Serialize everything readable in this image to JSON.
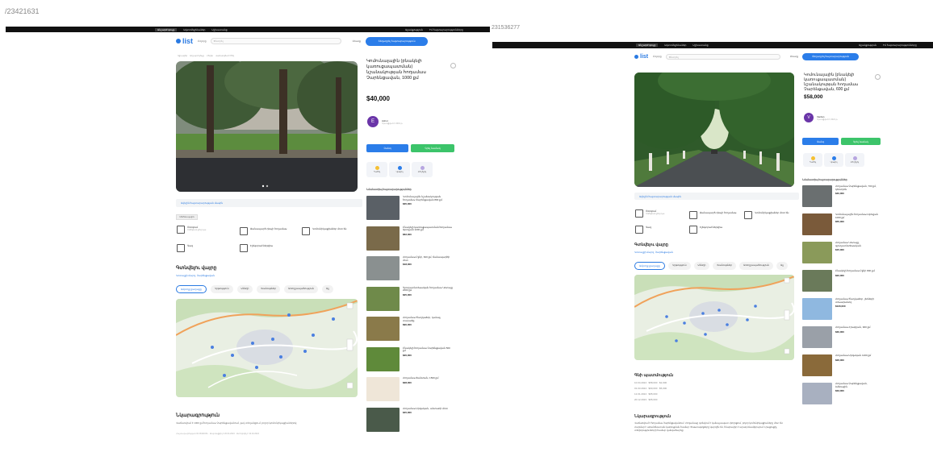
{
  "page_ids": {
    "left": "/23421631",
    "right": "231536277"
  },
  "topbar": {
    "items": [
      "Անշարժ գույք",
      "Ավտոմեքենաներ",
      "Աշխատանք"
    ],
    "right_items": [
      "Աջակցություն",
      "Իմ հայտարարությունները"
    ]
  },
  "header": {
    "logo": "list",
    "category": "Բոլորը",
    "search_placeholder": "Փնտրել",
    "login": "Մուտք",
    "post_button": "Տեղադրել հայտարարություն"
  },
  "left_listing": {
    "breadcrumbs": [
      "Գլխավոր",
      "Անշարժ գույք",
      "Հողեր",
      "Վաճառվում է հող"
    ],
    "title": "Կոմունալային (բնակելի կառուցապատման) նշանակության հողամաս Չարենցավան, 1000 քմ",
    "price": "$40,000",
    "seller": {
      "initial": "E",
      "name": "Ashot",
      "sub": "Գրանցված է 2019 թ."
    },
    "call_button": "Զանգ",
    "message_button": "Գրել նամակ",
    "actions": [
      "Պահել",
      "Կիսվել",
      "Բողոքել"
    ],
    "info_bar": "Ավելին հայտարարության մասին",
    "chip": "Կոմունալային",
    "features": [
      {
        "label": "Ոռոգում",
        "sub": "Ոռոգման ջուր կա"
      },
      {
        "label": "Ճանապարհ դեպի հողամաս",
        "sub": ""
      },
      {
        "label": "Կոմունիկացիաներ մոտ են",
        "sub": ""
      },
      {
        "label": "Գազ",
        "sub": ""
      },
      {
        "label": "Էլեկտրաէներգիա",
        "sub": ""
      }
    ],
    "location_title": "Գտնվելու վայրը",
    "address": "Կոտայքի մարզ, Չարենցավան",
    "map_tabs": [
      "Ամբողջ քաղաքը",
      "Կրթություն",
      "Սննդի",
      "Խանութներ",
      "Առողջապահություն",
      "Այլ"
    ],
    "description_title": "Նկարագրություն",
    "description": "Վաճառվում է 1000 քմ հողամաս Չարենցավանում, լավ տեղանքում, բոլոր կոմունիկացիաներով:",
    "meta": "Հայտարարության ID 23421631 · Թարմացվել է 20.04.2024 · Ստեղծվել է 10.04.2024",
    "similar_title": "Նմանատիպ հայտարարություններ",
    "similar": [
      {
        "text": "Կոմունալային նշանակության հողամաս Չարենցավան 800 քմ",
        "price": "$35,000"
      },
      {
        "text": "Բնակելի կառուցապատման հողամաս Աբովյան 1200 քմ",
        "price": "$62,000"
      },
      {
        "text": "Հողամաս Բջնի, 600 քմ, ճանապարհի մոտ",
        "price": "$18,000"
      },
      {
        "text": "Գյուղատնտեսական հողամաս Կոտայք 2000 քմ",
        "price": "$25,000"
      },
      {
        "text": "Հողամաս Ծաղկաձոր, կանաչ տարածք",
        "price": "$90,000"
      },
      {
        "text": "Բնակելի հողամաս Չարենցավան 500 քմ",
        "price": "$20,000"
      },
      {
        "text": "Հողամաս Ֆանտան, 1500 քմ",
        "price": "$28,000"
      },
      {
        "text": "Հողամաս Արզական, անտառի մոտ",
        "price": "$45,000"
      }
    ]
  },
  "right_listing": {
    "title": "Կոմունալային (բնակելի կառուցապատման) նշանակության հողամաս Չարենցավան, 600 քմ",
    "price": "$58,000",
    "seller": {
      "initial": "V",
      "name": "Vardan",
      "sub": "Գրանցված է 2021 թ."
    },
    "call_button": "Զանգ",
    "message_button": "Գրել նամակ",
    "actions": [
      "Պահել",
      "Կիսվել",
      "Բողոքել"
    ],
    "info_bar": "Ավելին հայտարարության մասին",
    "features": [
      {
        "label": "Ոռոգում",
        "sub": "Ոռոգման ջուր կա"
      },
      {
        "label": "Ճանապարհ դեպի հողամաս",
        "sub": ""
      },
      {
        "label": "Կոմունիկացիաներ մոտ են",
        "sub": ""
      },
      {
        "label": "Գազ",
        "sub": ""
      },
      {
        "label": "Էլեկտրաէներգիա",
        "sub": ""
      }
    ],
    "location_title": "Գտնվելու վայրը",
    "address": "Կոտայքի մարզ, Չարենցավան",
    "map_tabs": [
      "Ամբողջ քաղաքը",
      "Կրթություն",
      "Սննդի",
      "Խանութներ",
      "Առողջապահություն",
      "Այլ"
    ],
    "params_title": "Գնի պատմություն",
    "params": [
      {
        "date": "10.04.2024",
        "price": "$58,000",
        "delta": "$2,000"
      },
      {
        "date": "01.03.2024",
        "price": "$60,000",
        "delta": "$5,000"
      },
      {
        "date": "12.01.2024",
        "price": "$65,000",
        "delta": ""
      },
      {
        "date": "20.12.2023",
        "price": "$65,000",
        "delta": ""
      }
    ],
    "description_title": "Նկարագրություն",
    "description": "Վաճառվում է հողամաս Չարենցավանում: Հողամասը գտնվում է կանաչապատ փողոցում, բոլոր կոմունիկացիաները մոտ են: Հարմար է առանձնատան կառուցման համար: Փաստաթղթերը կարգին են, հնարավոր է արագ ձևակերպում: Լրացուցիչ տեղեկությունների համար զանգահարեք:",
    "similar_title": "Նմանատիպ հայտարարություններ",
    "similar": [
      {
        "text": "Հողամաս Չարենցավան, 700 քմ, կենտրոն",
        "price": "$40,000"
      },
      {
        "text": "Կոմունալային հողամաս Աբովյան 1000 քմ",
        "price": "$55,000"
      },
      {
        "text": "Հողամաս Կոտայք, գյուղատնտեսական",
        "price": "$15,000"
      },
      {
        "text": "Բնակելի հողամաս Բջնի 800 քմ",
        "price": "$22,000"
      },
      {
        "text": "Հողամաս Ծաղկաձոր, լեռների տեսարանով",
        "price": "$120,000"
      },
      {
        "text": "Հողամաս Հրազդան, 900 քմ",
        "price": "$30,000"
      },
      {
        "text": "Հողամաս Արզական 1200 քմ",
        "price": "$26,000"
      },
      {
        "text": "Հողամաս Չարենցավան, ձմեռային",
        "price": "$33,000"
      }
    ]
  },
  "colors": {
    "accent": "#2b7de9",
    "message": "#3cc46a",
    "avatar": "#6a35a8"
  }
}
